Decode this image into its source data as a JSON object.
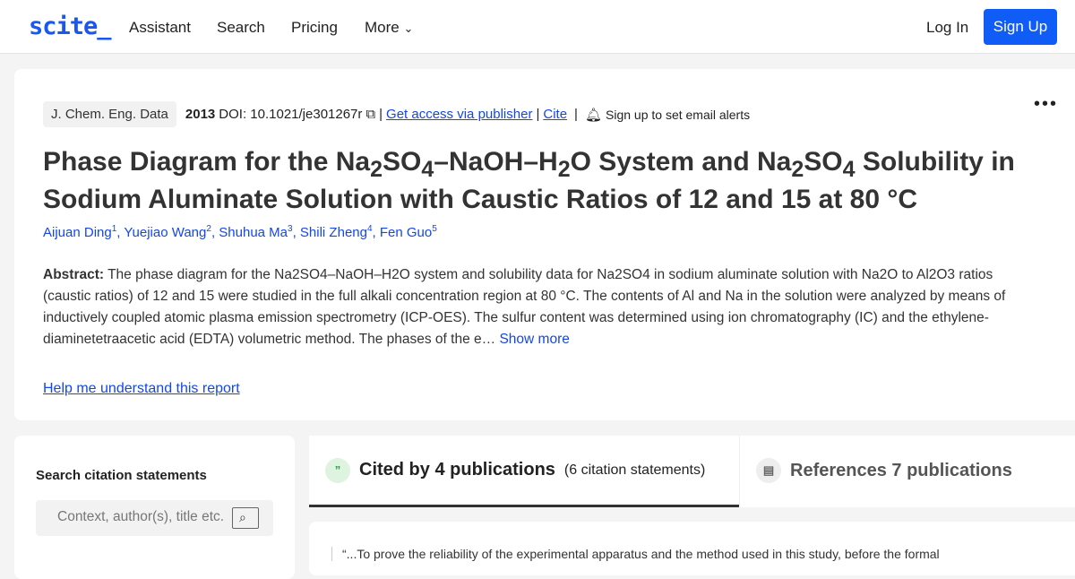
{
  "nav": {
    "logo": "scite_",
    "items": [
      "Assistant",
      "Search",
      "Pricing",
      "More"
    ],
    "login": "Log In",
    "signup": "Sign Up"
  },
  "paper": {
    "journal": "J. Chem. Eng. Data",
    "year": "2013",
    "doi": "DOI: 10.1021/je301267r",
    "access": "Get access via publisher",
    "cite": "Cite",
    "alerts": "Sign up to set email alerts",
    "title_parts": [
      "Phase Diagram for the Na",
      "2",
      "SO",
      "4",
      "–NaOH–H",
      "2",
      "O System and Na",
      "2",
      "SO",
      "4",
      " Solubility in Sodium Aluminate Solution with Caustic Ratios of 12 and 15 at 80 °C"
    ],
    "authors": [
      {
        "name": "Aijuan Ding",
        "n": "1"
      },
      {
        "name": "Yuejiao Wang",
        "n": "2"
      },
      {
        "name": "Shuhua Ma",
        "n": "3"
      },
      {
        "name": "Shili Zheng",
        "n": "4"
      },
      {
        "name": "Fen Guo",
        "n": "5"
      }
    ],
    "abstract_label": "Abstract:",
    "abstract": " The phase diagram for the Na2SO4–NaOH–H2O system and solubility data for Na2SO4 in sodium aluminate solution with Na2O to Al2O3 ratios (caustic ratios) of 12 and 15 were studied in the full alkali concentration region at 80 °C. The contents of Al and Na in the solution were analyzed by means of inductively coupled atomic plasma emission spectrometry (ICP-OES). The sulfur content was determined using ion chromatography (IC) and the ethylene-diaminetetraacetic acid (EDTA) volumetric method. The phases of the e…",
    "show_more": "Show more",
    "help": "Help me understand this report"
  },
  "sidebar": {
    "heading": "Search citation statements",
    "placeholder": "Context, author(s), title etc."
  },
  "tabs": {
    "cited": "Cited by 4 publications",
    "cited_sub": "(6 citation statements)",
    "refs": "References 7 publications"
  },
  "statement": "“...To prove the reliability of the experimental apparatus and the method used in this study, before the formal"
}
